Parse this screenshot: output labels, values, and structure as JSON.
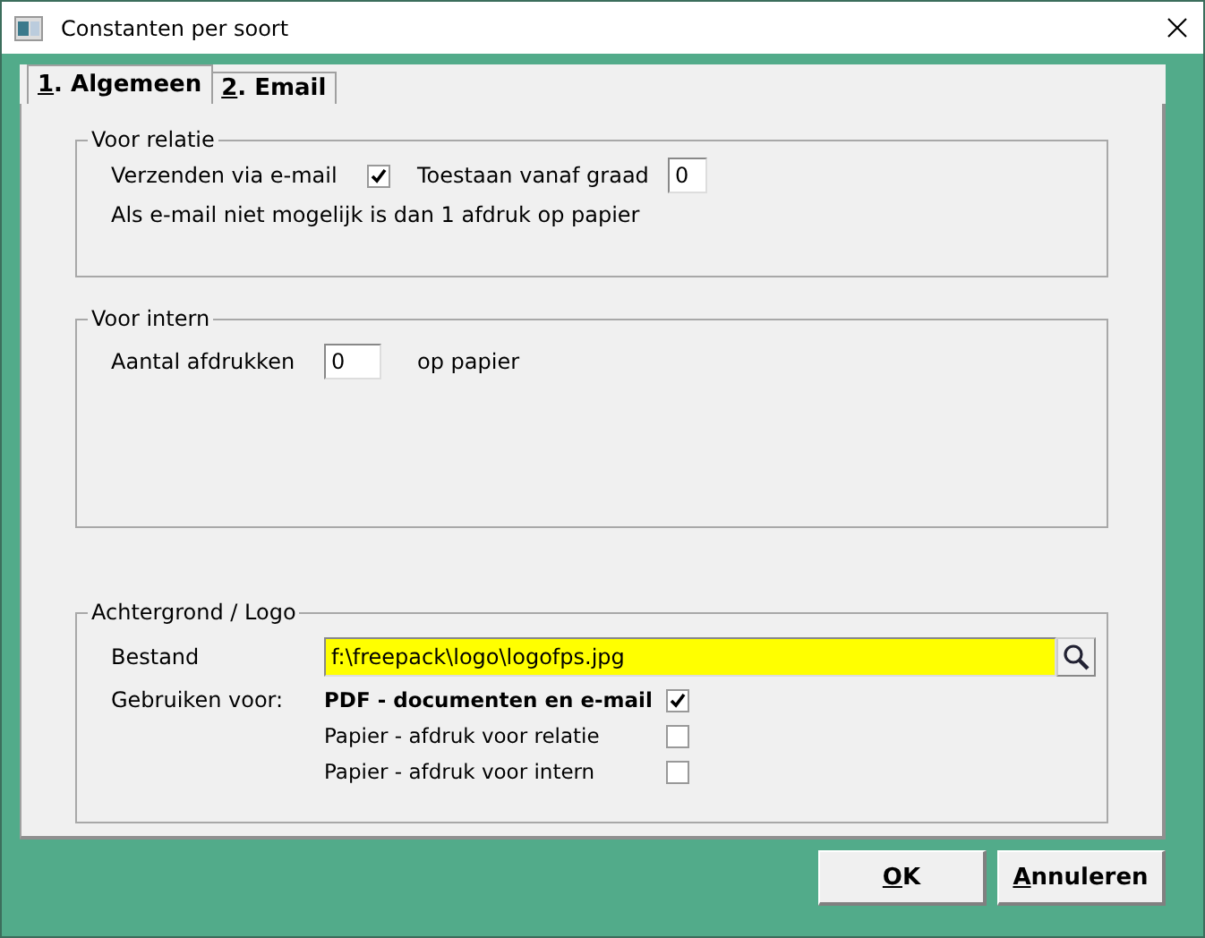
{
  "window": {
    "title": "Constanten per soort"
  },
  "tabs": [
    {
      "mnemonic": "1",
      "rest": ". Algemeen",
      "selected": true
    },
    {
      "mnemonic": "2",
      "rest": ". Email",
      "selected": false
    }
  ],
  "voor_relatie": {
    "legend": "Voor relatie",
    "send_label": "Verzenden via e-mail",
    "send_checked": true,
    "grade_label": "Toestaan vanaf graad",
    "grade_value": "0",
    "note": "Als e-mail niet mogelijk is dan 1 afdruk op papier"
  },
  "voor_intern": {
    "legend": "Voor intern",
    "count_label": "Aantal afdrukken",
    "count_value": "0",
    "suffix": "op papier"
  },
  "logo": {
    "legend": "Achtergrond / Logo",
    "file_label": "Bestand",
    "file_value": "f:\\freepack\\logo\\logofps.jpg",
    "use_label": "Gebruiken voor:",
    "options": [
      {
        "label": "PDF - documenten en e-mail",
        "checked": true
      },
      {
        "label": "Papier - afdruk voor relatie",
        "checked": false
      },
      {
        "label": "Papier - afdruk voor intern",
        "checked": false
      }
    ]
  },
  "buttons": [
    {
      "mnemonic": "O",
      "rest": "K"
    },
    {
      "mnemonic": "A",
      "rest": "nnuleren"
    }
  ]
}
